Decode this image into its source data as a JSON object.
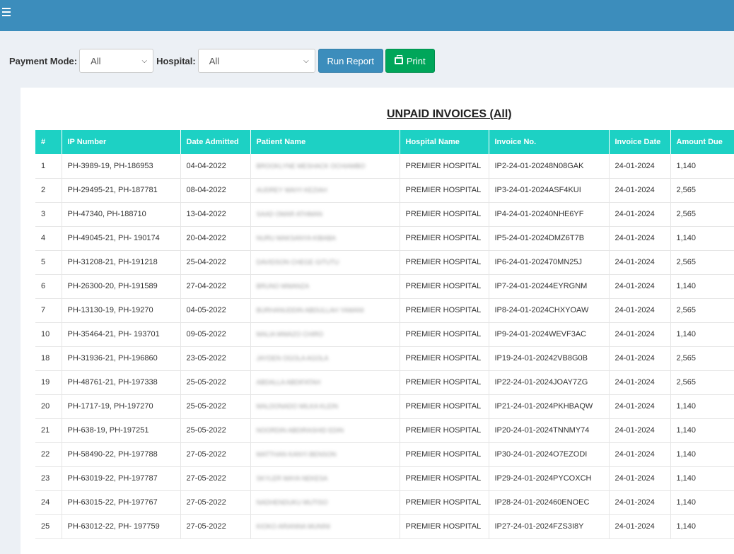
{
  "filters": {
    "payment_label": "Payment Mode:",
    "payment_value": "All",
    "hospital_label": "Hospital:",
    "hospital_value": "All",
    "run_label": "Run Report",
    "print_label": "Print"
  },
  "report": {
    "title": "UNPAID INVOICES (All)",
    "columns": [
      "#",
      "IP Number",
      "Date Admitted",
      "Patient Name",
      "Hospital Name",
      "Invoice No.",
      "Invoice Date",
      "Amount Due"
    ],
    "rows": [
      [
        "1",
        "PH-3989-19, PH-186953",
        "04-04-2022",
        "BROOKLYNE MESHACK OCHIAMBO",
        "PREMIER HOSPITAL",
        "IP2-24-01-20248N08GAK",
        "24-01-2024",
        "1,140"
      ],
      [
        "2",
        "PH-29495-21, PH-187781",
        "08-04-2022",
        "AUDREY WAIYI KEZIAH",
        "PREMIER HOSPITAL",
        "IP3-24-01-2024ASF4KUI",
        "24-01-2024",
        "2,565"
      ],
      [
        "3",
        "PH-47340, PH-188710",
        "13-04-2022",
        "SAAD OMAR ATHMAN",
        "PREMIER HOSPITAL",
        "IP4-24-01-20240NHE6YF",
        "24-01-2024",
        "2,565"
      ],
      [
        "4",
        "PH-49045-21, PH- 190174",
        "20-04-2022",
        "NURU MAKSANYA KIBABA",
        "PREMIER HOSPITAL",
        "IP5-24-01-2024DMZ6T7B",
        "24-01-2024",
        "1,140"
      ],
      [
        "5",
        "PH-31208-21, PH-191218",
        "25-04-2022",
        "DAVIDSON CHEGE GITUTU",
        "PREMIER HOSPITAL",
        "IP6-24-01-202470MN25J",
        "24-01-2024",
        "2,565"
      ],
      [
        "6",
        "PH-26300-20, PH-191589",
        "27-04-2022",
        "BRUNO MWANZA",
        "PREMIER HOSPITAL",
        "IP7-24-01-20244EYRGNM",
        "24-01-2024",
        "1,140"
      ],
      [
        "7",
        "PH-13130-19, PH-19270",
        "04-05-2022",
        "BURHANUDDIN ABDULLAH YAMANI",
        "PREMIER HOSPITAL",
        "IP8-24-01-2024CHXYOAW",
        "24-01-2024",
        "2,565"
      ],
      [
        "10",
        "PH-35464-21, PH- 193701",
        "09-05-2022",
        "MALIA MWAZO CHIRO",
        "PREMIER HOSPITAL",
        "IP9-24-01-2024WEVF3AC",
        "24-01-2024",
        "1,140"
      ],
      [
        "18",
        "PH-31936-21, PH-196860",
        "23-05-2022",
        "JAYDEN OGOLA AGOLA",
        "PREMIER HOSPITAL",
        "IP19-24-01-20242VB8G0B",
        "24-01-2024",
        "2,565"
      ],
      [
        "19",
        "PH-48761-21, PH-197338",
        "25-05-2022",
        "ABDALLA ABDIFATAH",
        "PREMIER HOSPITAL",
        "IP22-24-01-2024JOAY7ZG",
        "24-01-2024",
        "2,565"
      ],
      [
        "20",
        "PH-1717-19, PH-197270",
        "25-05-2022",
        "MALDONADO MILKA KLEIN",
        "PREMIER HOSPITAL",
        "IP21-24-01-2024PKHBAQW",
        "24-01-2024",
        "1,140"
      ],
      [
        "21",
        "PH-638-19, PH-197251",
        "25-05-2022",
        "NOORDIN ABDIRASHID EDIN",
        "PREMIER HOSPITAL",
        "IP20-24-01-2024TNNMY74",
        "24-01-2024",
        "1,140"
      ],
      [
        "22",
        "PH-58490-22, PH-197788",
        "27-05-2022",
        "MATTHAN KANYI BENSON",
        "PREMIER HOSPITAL",
        "IP30-24-01-2024O7EZODI",
        "24-01-2024",
        "1,140"
      ],
      [
        "23",
        "PH-63019-22, PH-197787",
        "27-05-2022",
        "SKYLER MAYA NEKESA",
        "PREMIER HOSPITAL",
        "IP29-24-01-2024PYCOXCH",
        "24-01-2024",
        "1,140"
      ],
      [
        "24",
        "PH-63015-22, PH-197767",
        "27-05-2022",
        "NADHENDUKU MUTISO",
        "PREMIER HOSPITAL",
        "IP28-24-01-202460ENOEC",
        "24-01-2024",
        "1,140"
      ],
      [
        "25",
        "PH-63012-22, PH- 197759",
        "27-05-2022",
        "KIOKO ARIANNA MUNINI",
        "PREMIER HOSPITAL",
        "IP27-24-01-2024FZS3I8Y",
        "24-01-2024",
        "1,140"
      ]
    ]
  }
}
